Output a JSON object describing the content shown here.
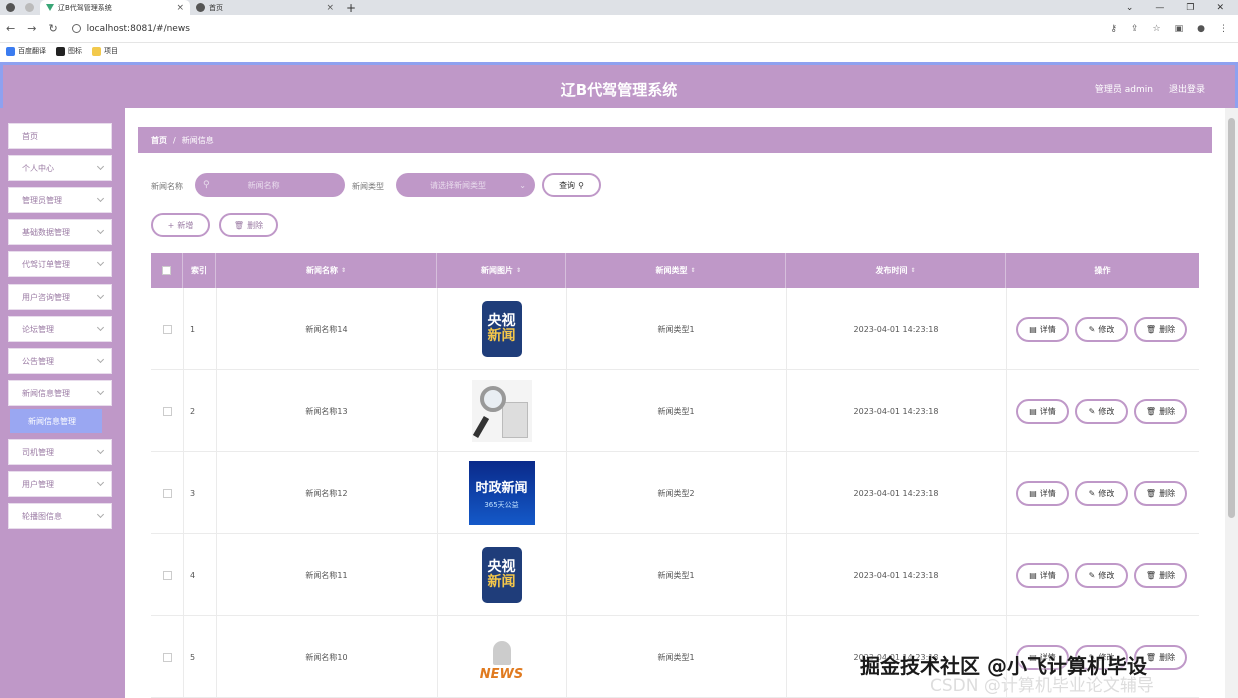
{
  "browser": {
    "tabs": [
      {
        "label": "辽B代驾管理系统",
        "active": true
      },
      {
        "label": "首页",
        "active": false
      }
    ],
    "url": "localhost:8081/#/news",
    "bookmarks": [
      "百度翻译",
      "图标",
      "项目"
    ]
  },
  "header": {
    "title": "辽B代驾管理系统",
    "user": "管理员 admin",
    "logout": "退出登录"
  },
  "sidebar": {
    "items": [
      {
        "label": "首页",
        "has_chevron": false
      },
      {
        "label": "个人中心",
        "has_chevron": true
      },
      {
        "label": "管理员管理",
        "has_chevron": true
      },
      {
        "label": "基础数据管理",
        "has_chevron": true
      },
      {
        "label": "代驾订单管理",
        "has_chevron": true
      },
      {
        "label": "用户咨询管理",
        "has_chevron": true
      },
      {
        "label": "论坛管理",
        "has_chevron": true
      },
      {
        "label": "公告管理",
        "has_chevron": true
      },
      {
        "label": "新闻信息管理",
        "has_chevron": true
      },
      {
        "label": "司机管理",
        "has_chevron": true
      },
      {
        "label": "用户管理",
        "has_chevron": true
      },
      {
        "label": "轮播图信息",
        "has_chevron": true
      }
    ],
    "active_submenu": "新闻信息管理"
  },
  "breadcrumb": {
    "home": "首页",
    "current": "新闻信息"
  },
  "search": {
    "name_label": "新闻名称",
    "name_placeholder": "新闻名称",
    "type_label": "新闻类型",
    "type_placeholder": "请选择新闻类型",
    "query_button": "查询"
  },
  "toolbar": {
    "add": "新增",
    "delete": "删除"
  },
  "table": {
    "columns": [
      "索引",
      "新闻名称",
      "新闻图片",
      "新闻类型",
      "发布时间",
      "操作"
    ],
    "actions": {
      "detail": "详情",
      "edit": "修改",
      "delete": "删除"
    },
    "rows": [
      {
        "index": "1",
        "name": "新闻名称14",
        "image": "cctv-news",
        "type": "新闻类型1",
        "time": "2023-04-01 14:23:18"
      },
      {
        "index": "2",
        "name": "新闻名称13",
        "image": "magnifier-news",
        "type": "新闻类型1",
        "time": "2023-04-01 14:23:18"
      },
      {
        "index": "3",
        "name": "新闻名称12",
        "image": "political-news",
        "type": "新闻类型2",
        "time": "2023-04-01 14:23:18"
      },
      {
        "index": "4",
        "name": "新闻名称11",
        "image": "cctv-news",
        "type": "新闻类型1",
        "time": "2023-04-01 14:23:18"
      },
      {
        "index": "5",
        "name": "新闻名称10",
        "image": "news-figure",
        "type": "新闻类型1",
        "time": "2023-04-01 14:23:18"
      }
    ],
    "image_text": {
      "cctv_top": "央视",
      "cctv_bottom": "新闻",
      "political": "时政新闻",
      "political_sub": "365天公益",
      "news_word": "NEWS"
    }
  },
  "watermark": {
    "line1": "掘金技术社区 @小飞计算机毕设",
    "line2": "CSDN @计算机毕业论文辅导"
  },
  "colors": {
    "theme": "#bf98c8",
    "accent": "#8ea1f0",
    "submenu": "#9aa7f2"
  }
}
